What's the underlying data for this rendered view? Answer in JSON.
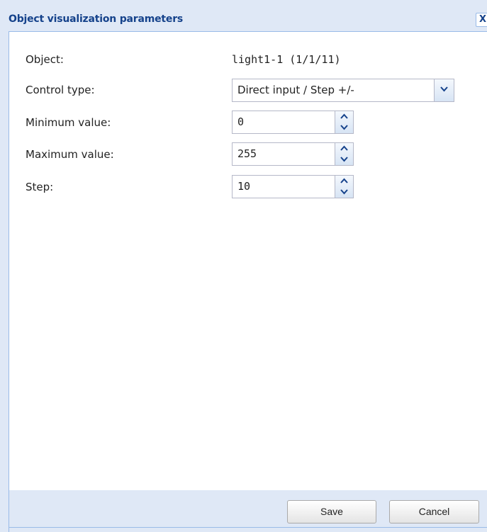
{
  "dialog": {
    "title": "Object visualization parameters",
    "close_label": "X"
  },
  "form": {
    "object": {
      "label": "Object:",
      "value": "light1-1 (1/1/11)"
    },
    "control_type": {
      "label": "Control type:",
      "selected": "Direct input / Step +/-"
    },
    "minimum": {
      "label": "Minimum value:",
      "value": "0"
    },
    "maximum": {
      "label": "Maximum value:",
      "value": "255"
    },
    "step": {
      "label": "Step:",
      "value": "10"
    }
  },
  "footer": {
    "save_label": "Save",
    "cancel_label": "Cancel"
  },
  "icons": {
    "close": "close-icon",
    "dropdown": "chevron-down-icon",
    "spin_up": "chevron-up-icon",
    "spin_down": "chevron-down-icon"
  },
  "colors": {
    "title_text": "#15428b",
    "frame_background": "#dfe8f6",
    "frame_border": "#99bbe8",
    "field_border": "#b5b8c8"
  }
}
